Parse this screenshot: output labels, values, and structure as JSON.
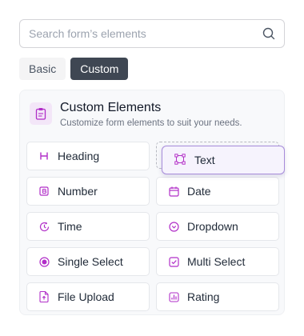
{
  "search": {
    "placeholder": "Search form’s elements",
    "icon": "search-icon"
  },
  "tabs": [
    {
      "label": "Basic",
      "active": false
    },
    {
      "label": "Custom",
      "active": true
    }
  ],
  "panel": {
    "title": "Custom Elements",
    "subtitle": "Customize form elements to suit your needs.",
    "icon": "clipboard-icon"
  },
  "dragging": {
    "label": "Text",
    "icon": "text-frame-icon"
  },
  "items": [
    {
      "label": "Heading",
      "icon": "heading-icon"
    },
    {
      "label": "Number",
      "icon": "number-icon"
    },
    {
      "label": "Date",
      "icon": "calendar-icon"
    },
    {
      "label": "Time",
      "icon": "clock-icon"
    },
    {
      "label": "Dropdown",
      "icon": "chevron-circle-icon"
    },
    {
      "label": "Single Select",
      "icon": "radio-icon"
    },
    {
      "label": "Multi Select",
      "icon": "checkbox-icon"
    },
    {
      "label": "File Upload",
      "icon": "file-icon"
    },
    {
      "label": "Rating",
      "icon": "bar-chart-icon"
    }
  ],
  "colors": {
    "accent": "#b12fc8",
    "active_tab": "#3f4753",
    "drag_border": "#a78bda"
  }
}
